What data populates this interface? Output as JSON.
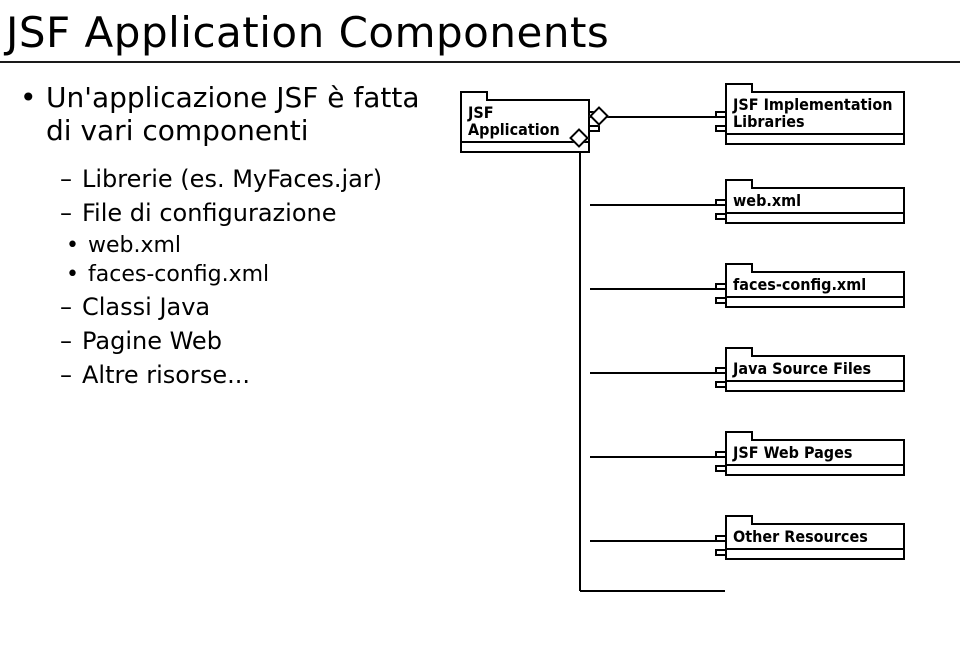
{
  "title": "JSF Application Components",
  "bullets": {
    "main": "Un'applicazione JSF è fatta di vari componenti",
    "sub": [
      "Librerie (es. MyFaces.jar)",
      "File di configurazione",
      "Classi Java",
      "Pagine Web",
      "Altre risorse..."
    ],
    "config_files": [
      "web.xml",
      "faces-config.xml"
    ]
  },
  "diagram": {
    "root": "JSF Application",
    "children": [
      "JSF Implementation\nLibraries",
      "web.xml",
      "faces-config.xml",
      "Java Source Files",
      "JSF Web Pages",
      "Other Resources"
    ]
  }
}
